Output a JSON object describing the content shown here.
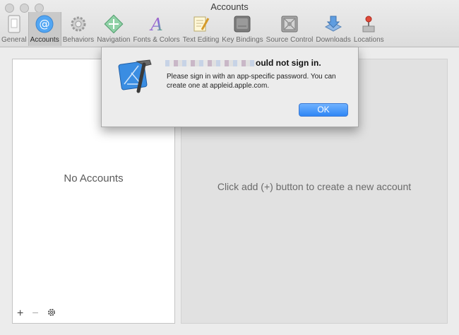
{
  "window": {
    "title": "Accounts"
  },
  "toolbar": {
    "items": [
      {
        "label": "General"
      },
      {
        "label": "Accounts"
      },
      {
        "label": "Behaviors"
      },
      {
        "label": "Navigation"
      },
      {
        "label": "Fonts & Colors"
      },
      {
        "label": "Text Editing"
      },
      {
        "label": "Key Bindings"
      },
      {
        "label": "Source Control"
      },
      {
        "label": "Downloads"
      },
      {
        "label": "Locations"
      }
    ],
    "active": "Accounts"
  },
  "accounts_list": {
    "empty_label": "No Accounts",
    "add_label": "+",
    "remove_label": "−"
  },
  "detail": {
    "empty_message": "Click add (+) button to create a new account"
  },
  "alert": {
    "title_visible": "ould not sign in.",
    "message": "Please sign in with an app-specific password. You can create one at appleid.apple.com.",
    "ok_label": "OK"
  },
  "colors": {
    "accent": "#2f86f5",
    "panel_bg": "#e1e1e1"
  }
}
